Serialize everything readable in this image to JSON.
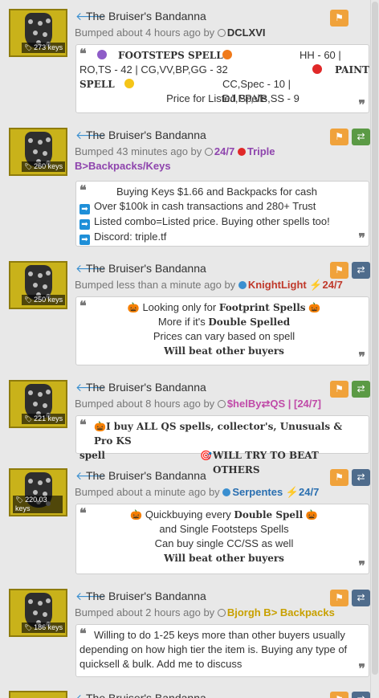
{
  "listings": [
    {
      "title": "The Bruiser's Bandanna",
      "price": "273 keys",
      "bumped": "Bumped about 4 hours ago by",
      "user": "DCLXVI",
      "note": {
        "row1_a": "FOOTSTEPS SPELL",
        "row1_b": "HH - 60 |",
        "row2_a": "RO,TS - 42 | CG,VV,BP,GG - 32",
        "row2_b": "PAINT",
        "row3_a": "SPELL",
        "row3_b": "CC,Spec - 10 | DJ,PP,VB,SS - 9",
        "row4": "Price for Listed Spells"
      }
    },
    {
      "title": "The Bruiser's Bandanna",
      "price": "260 keys",
      "bumped": "Bumped 43 minutes ago by",
      "user_a": "24/7",
      "user_b": "Triple",
      "user_c": "B>Backpacks/Keys",
      "note": {
        "line1": "Buying Keys $1.66 and Backpacks for cash",
        "line2": "Over $100k in cash transactions and 280+ Trust",
        "line3": "Listed combo=Listed price. Buying other spells too!",
        "line4": "Discord: triple.tf"
      }
    },
    {
      "title": "The Bruiser's Bandanna",
      "price": "250 keys",
      "bumped": "Bumped less than a minute ago by",
      "user": "KnightLight",
      "user_b": "24/7",
      "note": {
        "line1_a": "Looking only for",
        "line1_b": "Footprint Spells",
        "line2_a": "More if it's",
        "line2_b": "Double Spelled",
        "line3": "Prices can vary based on spell",
        "line4": "Will beat other buyers"
      }
    },
    {
      "title": "The Bruiser's Bandanna",
      "price": "221 keys",
      "bumped": "Bumped about 8 hours ago by",
      "user": "$helBy⇄QS",
      "user_b": "| [24/7]",
      "note": {
        "line1": "I buy ALL QS spells, collector's, Unusuals & Pro KS",
        "line2_a": "spell",
        "line2_b": "WILL TRY TO BEAT OTHERS"
      }
    },
    {
      "title": "The Bruiser's Bandanna",
      "price": "220.03 keys",
      "bumped": "Bumped about a minute ago by",
      "user": "Serpentes",
      "user_b": "24/7",
      "note": {
        "line1_a": "Quickbuying every",
        "line1_b": "Double Spell",
        "line2": "and Single Footsteps Spells",
        "line3": "Can buy single CC/SS as well",
        "line4": "Will beat other buyers"
      }
    },
    {
      "title": "The Bruiser's Bandanna",
      "price": "186 keys",
      "bumped": "Bumped about 2 hours ago by",
      "user": "Bjorgh B> Backpacks",
      "note": {
        "text": "Willing to do 1-25 keys more than other buyers usually depending on how high tier the item is. Buying any type of quicksell & bulk. Add me to discuss"
      }
    },
    {
      "title": "The Bruiser's Bandanna"
    }
  ],
  "colors": {
    "flag": "#f0a23b",
    "trade_green": "#5b9a45",
    "trade_blue": "#4f6c8c",
    "link_purple": "#8e44ad",
    "link_red": "#c0392b",
    "link_blue": "#2a6fb0",
    "link_gold": "#c8a000"
  },
  "icons": [
    "arrow-left-icon",
    "flag-icon",
    "swap-icon",
    "quote-icon",
    "tag-icon"
  ]
}
